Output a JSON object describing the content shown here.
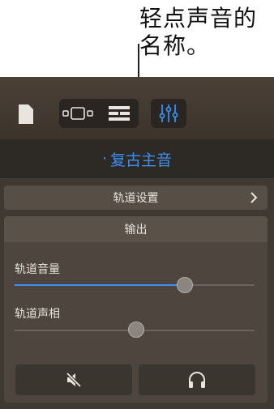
{
  "callout": {
    "line1": "轻点声音的",
    "line2": "名称。"
  },
  "toolbar": {
    "icons": [
      "document-icon",
      "track-view-icon",
      "list-view-icon",
      "mixer-controls-icon"
    ]
  },
  "sound": {
    "name": "复古主音"
  },
  "track_settings": {
    "label": "轨道设置"
  },
  "output": {
    "header": "输出",
    "volume": {
      "label": "轨道音量",
      "value": 0.7
    },
    "pan": {
      "label": "轨道声相",
      "value": 0.5
    }
  },
  "buttons": {
    "mute_icon": "mute-speaker-icon",
    "solo_icon": "headphones-icon"
  },
  "colors": {
    "accent": "#3a8ff2",
    "panel": "#3f3932"
  }
}
